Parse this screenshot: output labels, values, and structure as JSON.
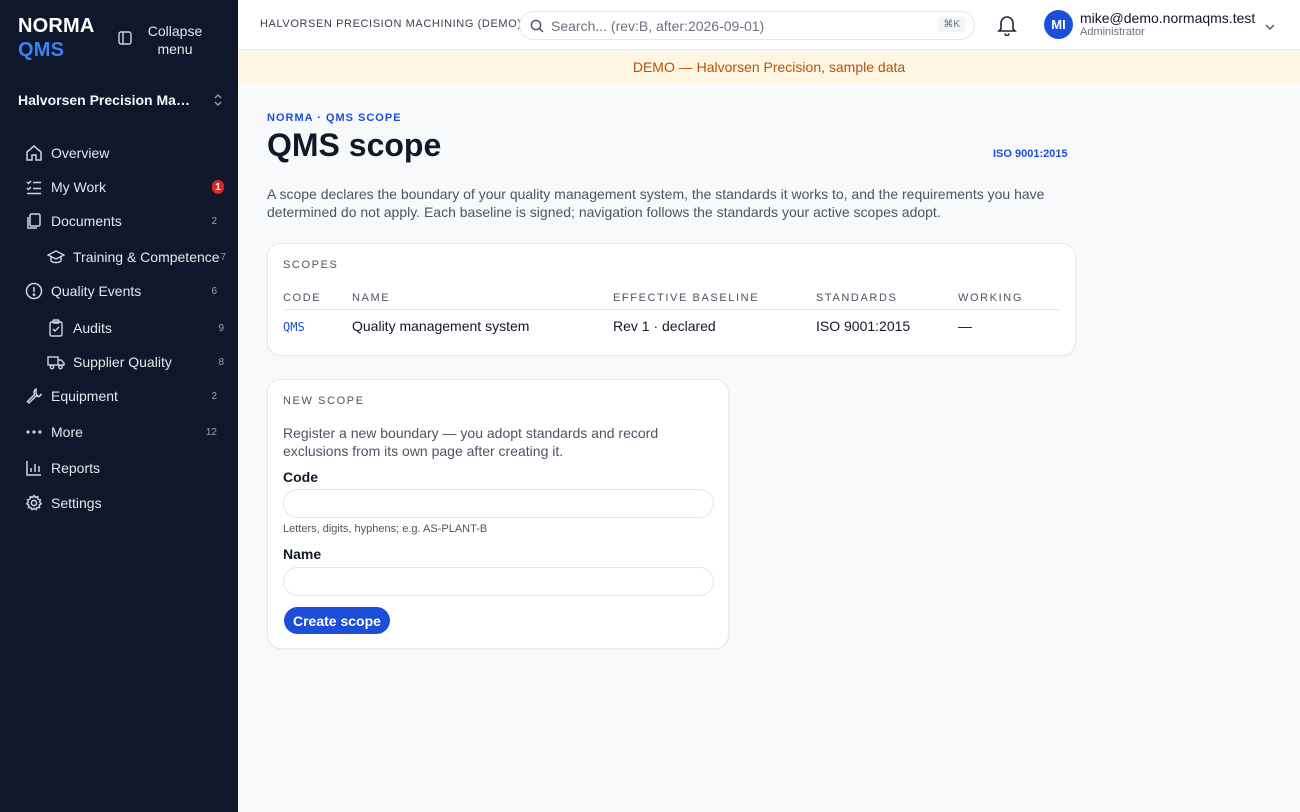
{
  "brand": {
    "line1": "NORMA",
    "line2": "QMS"
  },
  "sidebar": {
    "collapse_label": "Collapse menu",
    "org_name": "Halvorsen Precision Machi...",
    "items": [
      {
        "label": "Overview",
        "icon": "home-icon"
      },
      {
        "label": "My Work",
        "icon": "checklist-icon",
        "badge": "1"
      },
      {
        "label": "Documents",
        "icon": "documents-icon",
        "count": "2"
      },
      {
        "label": "Training & Competence",
        "icon": "graduation-cap-icon",
        "count": "7"
      },
      {
        "label": "Quality Events",
        "icon": "alert-circle-icon",
        "count": "6"
      },
      {
        "label": "Audits",
        "icon": "clipboard-check-icon",
        "count": "9"
      },
      {
        "label": "Supplier Quality",
        "icon": "truck-icon",
        "count": "8"
      },
      {
        "label": "Equipment",
        "icon": "wrench-icon",
        "count": "2"
      },
      {
        "label": "More",
        "icon": "more-dots-icon",
        "count": "12"
      },
      {
        "label": "Reports",
        "icon": "bar-chart-icon"
      },
      {
        "label": "Settings",
        "icon": "gear-icon"
      }
    ]
  },
  "header": {
    "org_title": "HALVORSEN PRECISION MACHINING (DEMO)",
    "search_placeholder": "Search... (rev:B, after:2026-09-01)",
    "search_shortcut": "⌘K",
    "user": {
      "initials": "MI",
      "email": "mike@demo.normaqms.test",
      "role": "Administrator"
    }
  },
  "banner": "DEMO — Halvorsen Precision, sample data",
  "page": {
    "eyebrow": "NORMA · QMS SCOPE",
    "title": "QMS scope",
    "standard_tag": "ISO 9001:2015",
    "intro": "A scope declares the boundary of your quality management system, the standards it works to, and the requirements you have determined do not apply. Each baseline is signed; navigation follows the standards your active scopes adopt."
  },
  "scopes": {
    "label": "SCOPES",
    "columns": [
      "CODE",
      "NAME",
      "EFFECTIVE BASELINE",
      "STANDARDS",
      "WORKING"
    ],
    "rows": [
      {
        "code": "QMS",
        "name": "Quality management system",
        "baseline": "Rev 1 · declared",
        "standards": "ISO 9001:2015",
        "working": "—"
      }
    ]
  },
  "new_scope": {
    "label": "NEW SCOPE",
    "description": "Register a new boundary — you adopt standards and record exclusions from its own page after creating it.",
    "code_label": "Code",
    "code_value": "",
    "code_hint": "Letters, digits, hyphens; e.g. AS-PLANT-B",
    "name_label": "Name",
    "name_value": "",
    "submit_label": "Create scope"
  }
}
